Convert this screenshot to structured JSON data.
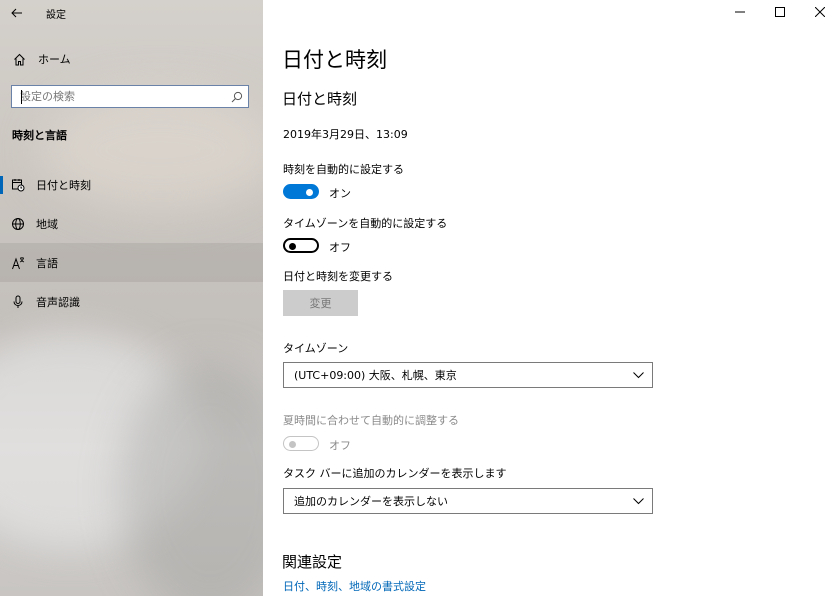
{
  "window": {
    "title": "設定",
    "controls": [
      "minimize-icon",
      "maximize-icon",
      "close-icon"
    ]
  },
  "sidebar": {
    "home_label": "ホーム",
    "search_placeholder": "設定の検索",
    "section_title": "時刻と言語",
    "items": [
      {
        "label": "日付と時刻",
        "icon": "calendar-clock-icon",
        "selected": true
      },
      {
        "label": "地域",
        "icon": "globe-icon"
      },
      {
        "label": "言語",
        "icon": "language-icon"
      },
      {
        "label": "音声認識",
        "icon": "microphone-icon"
      }
    ]
  },
  "main": {
    "page_title": "日付と時刻",
    "section_title": "日付と時刻",
    "current_datetime": "2019年3月29日、13:09",
    "auto_time": {
      "label": "時刻を自動的に設定する",
      "state": "オン",
      "on": true
    },
    "auto_timezone": {
      "label": "タイムゾーンを自動的に設定する",
      "state": "オフ",
      "on": false
    },
    "change": {
      "label": "日付と時刻を変更する",
      "button": "変更"
    },
    "timezone": {
      "label": "タイムゾーン",
      "value": "(UTC+09:00) 大阪、札幌、東京"
    },
    "dst": {
      "label": "夏時間に合わせて自動的に調整する",
      "state": "オフ",
      "enabled": false
    },
    "calendar": {
      "label": "タスク バーに追加のカレンダーを表示します",
      "value": "追加のカレンダーを表示しない"
    },
    "related": {
      "title": "関連設定",
      "link": "日付、時刻、地域の書式設定"
    }
  },
  "colors": {
    "accent": "#0078d7",
    "link": "#0067b8"
  }
}
